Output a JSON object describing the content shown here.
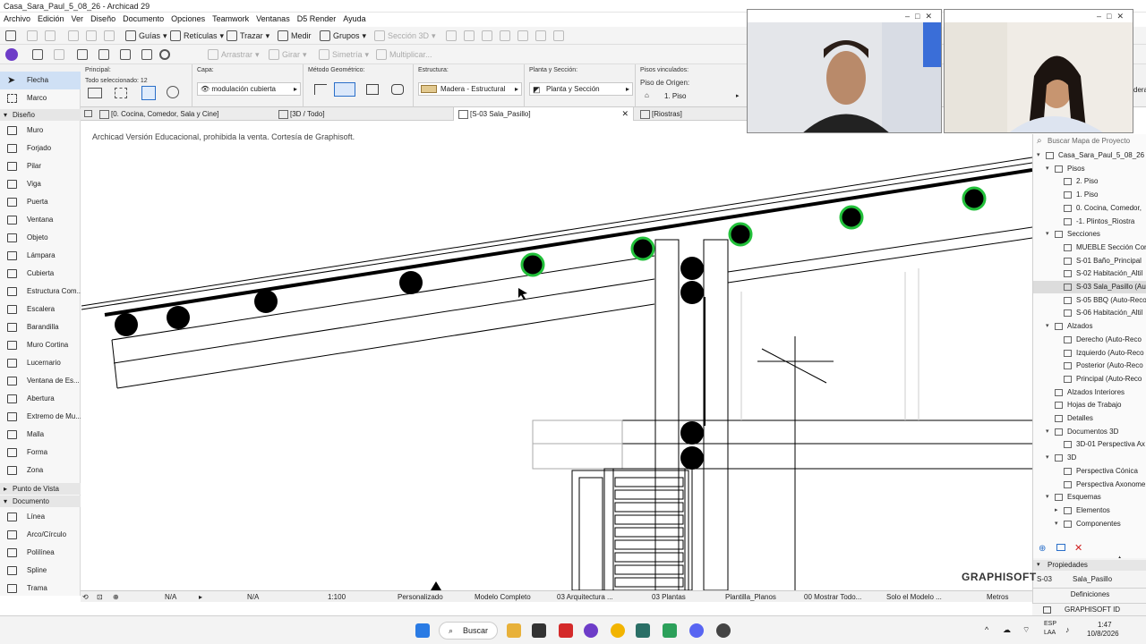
{
  "window": {
    "title": "Casa_Sara_Paul_5_08_26 - Archicad 29"
  },
  "menu": [
    "Archivo",
    "Edición",
    "Ver",
    "Diseño",
    "Documento",
    "Opciones",
    "Teamwork",
    "Ventanas",
    "D5 Render",
    "Ayuda"
  ],
  "toolbar": {
    "guias": "Guías",
    "reticulas": "Retículas",
    "trazar": "Trazar",
    "medir": "Medir",
    "grupos": "Grupos",
    "seccion3d": "Sección 3D",
    "arrastrar": "Arrastrar",
    "girar": "Girar",
    "simetria": "Simetría",
    "multiplicar": "Multiplicar..."
  },
  "infobox": {
    "principal_label": "Principal:",
    "selected": "Todo seleccionado: 12",
    "capa_label": "Capa:",
    "capa_value": "modulación cubierta",
    "metodo_label": "Método Geométrico:",
    "estructura_label": "Estructura:",
    "estructura_value": "Madera - Estructural",
    "planta_label": "Planta y Sección:",
    "planta_value": "Planta y Sección",
    "pisos_label": "Pisos vinculados:",
    "piso_origen": "Piso de Origen:",
    "piso_value": "1. Piso",
    "cut_text": "dera"
  },
  "toolbox": {
    "flecha": "Flecha",
    "marco": "Marco",
    "diseno": "Diseño",
    "design_tools": [
      "Muro",
      "Forjado",
      "Pilar",
      "Viga",
      "Puerta",
      "Ventana",
      "Objeto",
      "Lámpara",
      "Cubierta",
      "Estructura Com...",
      "Escalera",
      "Barandilla",
      "Muro Cortina",
      "Lucernario",
      "Ventana de Es...",
      "Abertura",
      "Extremo de Mu...",
      "Malla",
      "Forma",
      "Zona"
    ],
    "punto_vista": "Punto de Vista",
    "documento": "Documento",
    "doc_tools": [
      "Línea",
      "Arco/Círculo",
      "Polilínea",
      "Spline",
      "Trama"
    ]
  },
  "tabs": [
    {
      "label": "[0. Cocina, Comedor, Sala y Cine]"
    },
    {
      "label": "[3D / Todo]"
    },
    {
      "label": "[S-03 Sala_Pasillo]",
      "active": true
    },
    {
      "label": "[Riostras]"
    }
  ],
  "canvas": {
    "watermark": "Archicad Versión Educacional, prohibida la venta. Cortesía de Graphisoft."
  },
  "navigator": {
    "search": "Buscar Mapa de Proyecto",
    "rows": [
      {
        "level": 0,
        "arrow": "▾",
        "text": "Casa_Sara_Paul_5_08_26"
      },
      {
        "level": 1,
        "arrow": "▾",
        "text": "Pisos"
      },
      {
        "level": 2,
        "arrow": "",
        "text": "2. Piso"
      },
      {
        "level": 2,
        "arrow": "",
        "text": "1. Piso"
      },
      {
        "level": 2,
        "arrow": "",
        "text": "0. Cocina, Comedor,"
      },
      {
        "level": 2,
        "arrow": "",
        "text": "-1. Plintos_Riostra"
      },
      {
        "level": 1,
        "arrow": "▾",
        "text": "Secciones"
      },
      {
        "level": 2,
        "arrow": "",
        "text": "MUEBLE Sección Cor"
      },
      {
        "level": 2,
        "arrow": "",
        "text": "S-01 Baño_Principal"
      },
      {
        "level": 2,
        "arrow": "",
        "text": "S-02 Habitación_Altil"
      },
      {
        "level": 2,
        "arrow": "",
        "text": "S-03 Sala_Pasillo (Au",
        "selected": true
      },
      {
        "level": 2,
        "arrow": "",
        "text": "S-05 BBQ (Auto-Reco"
      },
      {
        "level": 2,
        "arrow": "",
        "text": "S-06 Habitación_Altil"
      },
      {
        "level": 1,
        "arrow": "▾",
        "text": "Alzados"
      },
      {
        "level": 2,
        "arrow": "",
        "text": "Derecho (Auto-Reco"
      },
      {
        "level": 2,
        "arrow": "",
        "text": "Izquierdo (Auto-Reco"
      },
      {
        "level": 2,
        "arrow": "",
        "text": "Posterior (Auto-Reco"
      },
      {
        "level": 2,
        "arrow": "",
        "text": "Principal (Auto-Reco"
      },
      {
        "level": 1,
        "arrow": "",
        "text": "Alzados Interiores"
      },
      {
        "level": 1,
        "arrow": "",
        "text": "Hojas de Trabajo"
      },
      {
        "level": 1,
        "arrow": "",
        "text": "Detalles"
      },
      {
        "level": 1,
        "arrow": "▾",
        "text": "Documentos 3D"
      },
      {
        "level": 2,
        "arrow": "",
        "text": "3D-01 Perspectiva Ax"
      },
      {
        "level": 1,
        "arrow": "▾",
        "text": "3D"
      },
      {
        "level": 2,
        "arrow": "",
        "text": "Perspectiva Cónica"
      },
      {
        "level": 2,
        "arrow": "",
        "text": "Perspectiva Axonome"
      },
      {
        "level": 1,
        "arrow": "▾",
        "text": "Esquemas"
      },
      {
        "level": 2,
        "arrow": "▸",
        "text": "Elementos"
      },
      {
        "level": 2,
        "arrow": "▾",
        "text": "Componentes"
      }
    ]
  },
  "properties": {
    "header": "Propiedades",
    "id": "S-03",
    "name": "Sala_Pasillo",
    "definiciones": "Definiciones",
    "graphisoft_id": "GRAPHISOFT ID",
    "logo": "GRAPHISOFT"
  },
  "statusbar": {
    "na1": "N/A",
    "na2": "N/A",
    "scale": "1:100",
    "personalizado": "Personalizado",
    "modelo": "Modelo Completo",
    "arquitectura": "03 Arquitectura ...",
    "plantas": "03 Plantas",
    "plantilla": "Plantilla_Planos",
    "mostrar": "00 Mostrar Todo...",
    "solo": "Solo el Modelo ...",
    "metros": "Metros"
  },
  "taskbar": {
    "search": "Buscar",
    "lang1": "ESP",
    "lang2": "LAA",
    "time": "1:47",
    "date": "10/8/2026"
  },
  "colors": {
    "accent": "#2a6fc9",
    "selection_green": "#22c03a",
    "canvas_bg": "#ffffff"
  }
}
